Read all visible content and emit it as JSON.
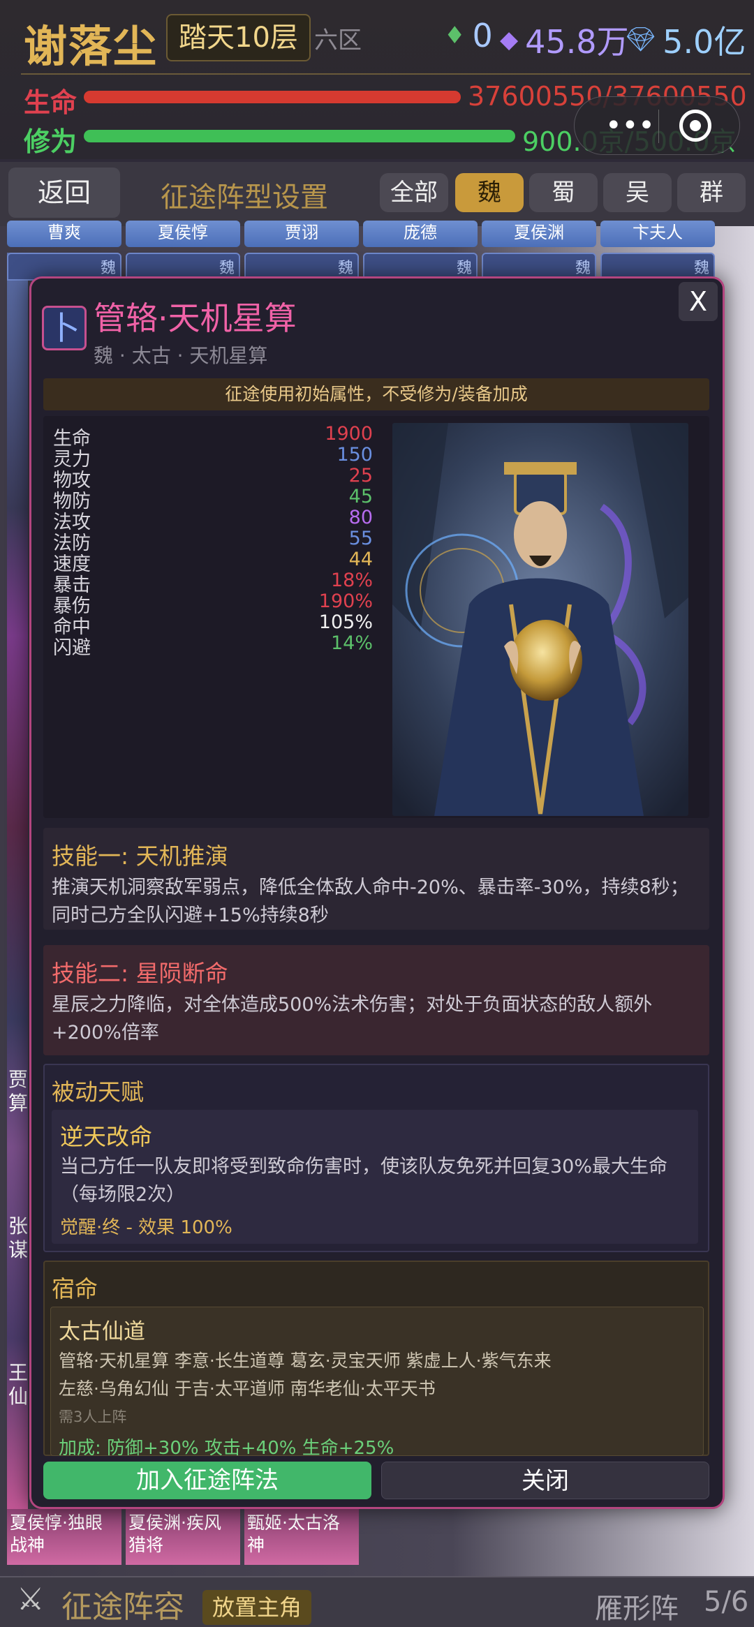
{
  "header": {
    "player_name": "谢落尘",
    "tower_label": "踏天10层",
    "zone": "六区",
    "currency": [
      {
        "icon": "leaf-icon",
        "value": "0",
        "color": "#6cc"
      },
      {
        "icon": "purple-crystal-icon",
        "value": "45.8万",
        "color": "#b19bff"
      },
      {
        "icon": "diamond-icon",
        "value": "5.0亿",
        "color": "#9ed0ff"
      }
    ],
    "hp": {
      "label": "生命",
      "value": "37600550/37600550",
      "fill": 1.0,
      "color": "#d63a30"
    },
    "cultivation": {
      "label": "修为",
      "value": "900.0京/500.0京",
      "fill": 1.0,
      "color": "#3fbf56"
    }
  },
  "nav": {
    "back_label": "返回",
    "page_title": "征途阵型设置",
    "faction_tabs": [
      {
        "label": "全部",
        "active": false
      },
      {
        "label": "魏",
        "active": true
      },
      {
        "label": "蜀",
        "active": false
      },
      {
        "label": "吴",
        "active": false
      },
      {
        "label": "群",
        "active": false
      }
    ]
  },
  "background_cards": {
    "top_names": [
      "曹爽",
      "夏侯惇",
      "贾诩",
      "庞德",
      "夏侯渊",
      "卞夫人"
    ],
    "faction_badge": "魏",
    "left_partial_labels": [
      "贾\n算",
      "张\n谋",
      "王\n仙"
    ],
    "bottom_cards": [
      {
        "name": "夏侯惇·独眼战神"
      },
      {
        "name": "夏侯渊·疾风猎将"
      },
      {
        "name": "甄姬·太古洛神"
      }
    ]
  },
  "modal": {
    "seal_char": "卜",
    "name": "管辂·天机星算",
    "subtitle": "魏 · 太古 · 天机星算",
    "notice": "征途使用初始属性，不受修为/装备加成",
    "close_label": "X",
    "stats": [
      {
        "label": "生命",
        "value": "1900",
        "color": "#e0414f"
      },
      {
        "label": "灵力",
        "value": "150",
        "color": "#6a8fe0"
      },
      {
        "label": "物攻",
        "value": "25",
        "color": "#e0414f"
      },
      {
        "label": "物防",
        "value": "45",
        "color": "#5cc06a"
      },
      {
        "label": "法攻",
        "value": "80",
        "color": "#b86cf0"
      },
      {
        "label": "法防",
        "value": "55",
        "color": "#6a8fe0"
      },
      {
        "label": "速度",
        "value": "44",
        "color": "#e2b657"
      },
      {
        "label": "暴击",
        "value": "18%",
        "color": "#e0414f"
      },
      {
        "label": "暴伤",
        "value": "190%",
        "color": "#e0414f"
      },
      {
        "label": "命中",
        "value": "105%",
        "color": "#f0f0f0"
      },
      {
        "label": "闪避",
        "value": "14%",
        "color": "#5cc06a"
      }
    ],
    "skill1": {
      "title": "技能一: 天机推演",
      "desc": "推演天机洞察敌军弱点，降低全体敌人命中-20%、暴击率-30%，持续8秒；同时己方全队闪避+15%持续8秒"
    },
    "skill2": {
      "title": "技能二: 星陨断命",
      "desc": "星辰之力降临，对全体造成500%法术伤害；对处于负面状态的敌人额外+200%倍率"
    },
    "passive": {
      "header": "被动天赋",
      "name": "逆天改命",
      "desc": "当己方任一队友即将受到致命伤害时，使该队友免死并回复30%最大生命（每场限2次）",
      "awaken": "觉醒·终 - 效果 100%"
    },
    "destiny": {
      "header": "宿命",
      "name": "太古仙道",
      "members_line1": "管辂·天机星算 李意·长生道尊 葛玄·灵宝天师 紫虚上人·紫气东来",
      "members_line2": "左慈·乌角幻仙 于吉·太平道师 南华老仙·太平天书",
      "requirement": "需3人上阵",
      "bonus": "加成: 防御+30% 攻击+40% 生命+25%"
    },
    "join_label": "加入征途阵法",
    "close_button_label": "关闭"
  },
  "footer": {
    "title": "征途阵容",
    "place_button": "放置主角",
    "formation": "雁形阵",
    "count": "5/6"
  }
}
